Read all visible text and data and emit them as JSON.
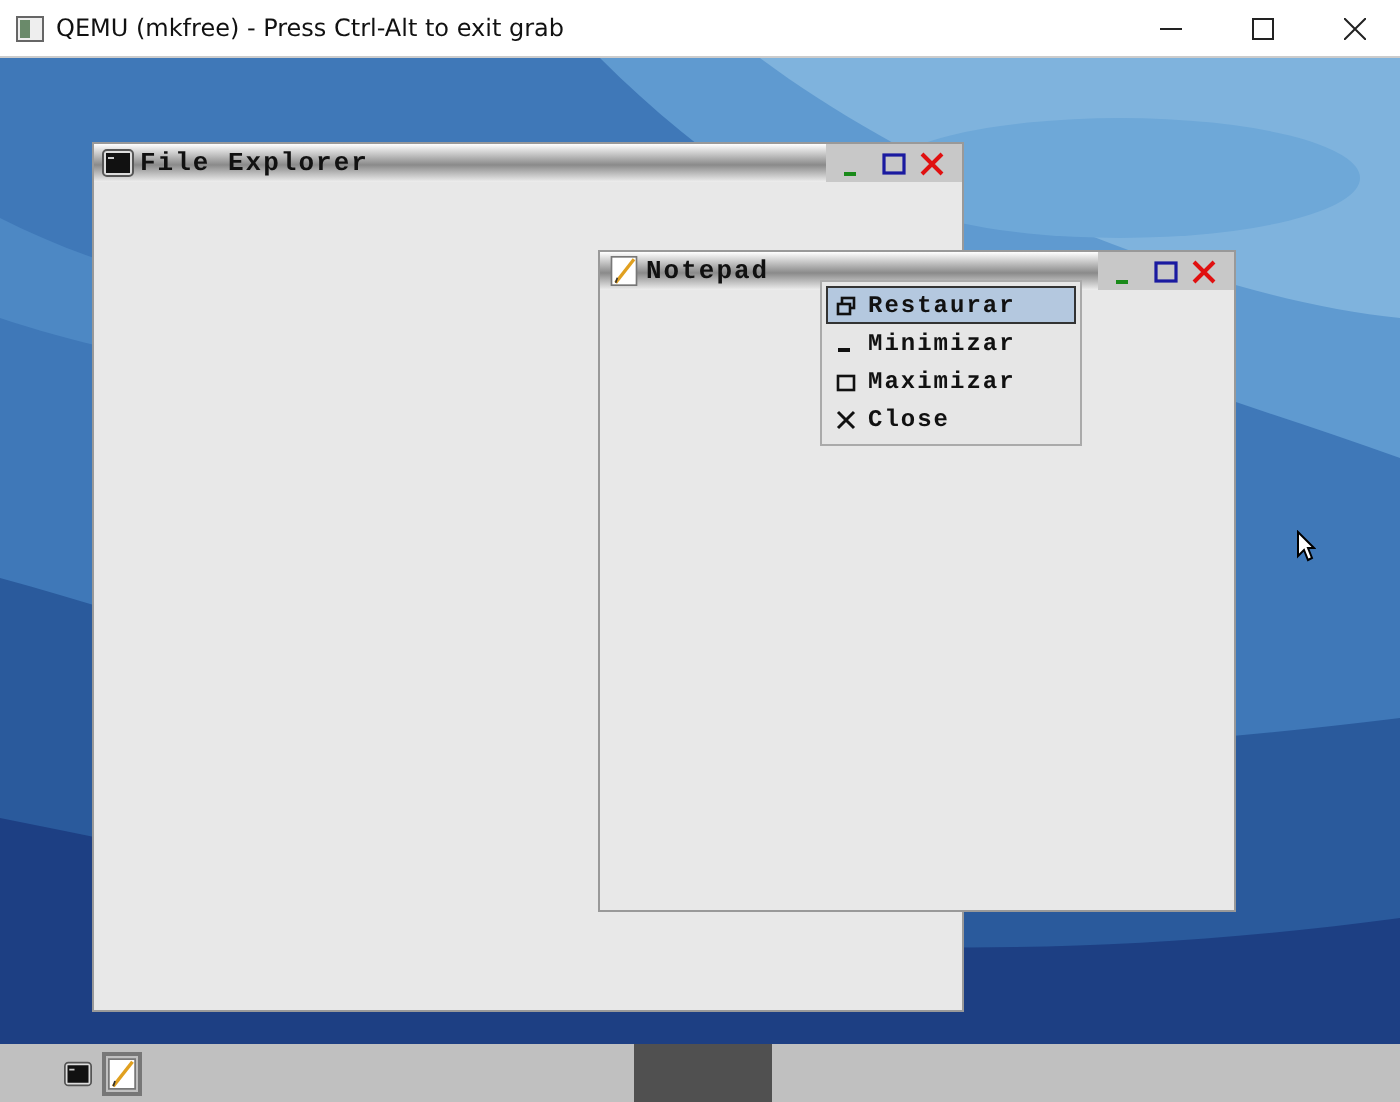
{
  "host_window": {
    "title": "QEMU (mkfree) - Press Ctrl-Alt to exit grab"
  },
  "windows": [
    {
      "kind": "explorer",
      "title": "File Explorer"
    },
    {
      "kind": "notepad",
      "title": "Notepad"
    }
  ],
  "context_menu": {
    "items": [
      {
        "kind": "restore",
        "label": "Restaurar",
        "selected": true
      },
      {
        "kind": "minimize",
        "label": "Minimizar",
        "selected": false
      },
      {
        "kind": "maximize",
        "label": "Maximizar",
        "selected": false
      },
      {
        "kind": "close",
        "label": "Close",
        "selected": false
      }
    ]
  },
  "taskbar": {
    "items": [
      {
        "kind": "explorer",
        "selected": false
      },
      {
        "kind": "notepad",
        "selected": true
      }
    ]
  }
}
